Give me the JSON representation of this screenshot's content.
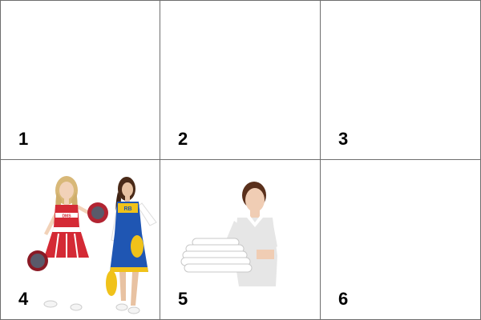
{
  "cells": [
    {
      "number": "1",
      "content": "empty"
    },
    {
      "number": "2",
      "content": "empty"
    },
    {
      "number": "3",
      "content": "empty"
    },
    {
      "number": "4",
      "content": "two cheerleaders with pom-poms"
    },
    {
      "number": "5",
      "content": "housekeeper holding folded towels"
    },
    {
      "number": "6",
      "content": "empty"
    }
  ],
  "colors": {
    "grid_line": "#6e6e6e",
    "red_uniform": "#d42a35",
    "blue_uniform": "#1f56b3",
    "gold": "#f0c21a"
  }
}
